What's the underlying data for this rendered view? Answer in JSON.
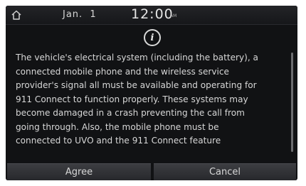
{
  "status_bar": {
    "home_icon": "home-icon",
    "date": "Jan.  1",
    "time": "12:00",
    "ampm": "AM"
  },
  "dialog": {
    "info_icon": "info-icon",
    "info_glyph": "i",
    "lines": [
      "The vehicle's electrical system (including the battery), a",
      "connected mobile phone and the wireless service",
      "provider's signal all must be available and operating for",
      "911 Connect to function properly. These systems may",
      "become damaged in a crash preventing the call from",
      "going through. Also, the mobile phone must be",
      "connected to UVO and the 911 Connect feature"
    ],
    "buttons": {
      "agree": "Agree",
      "cancel": "Cancel"
    }
  },
  "colors": {
    "background": "#111214",
    "text": "#d7d7d7",
    "button": "#323338"
  }
}
